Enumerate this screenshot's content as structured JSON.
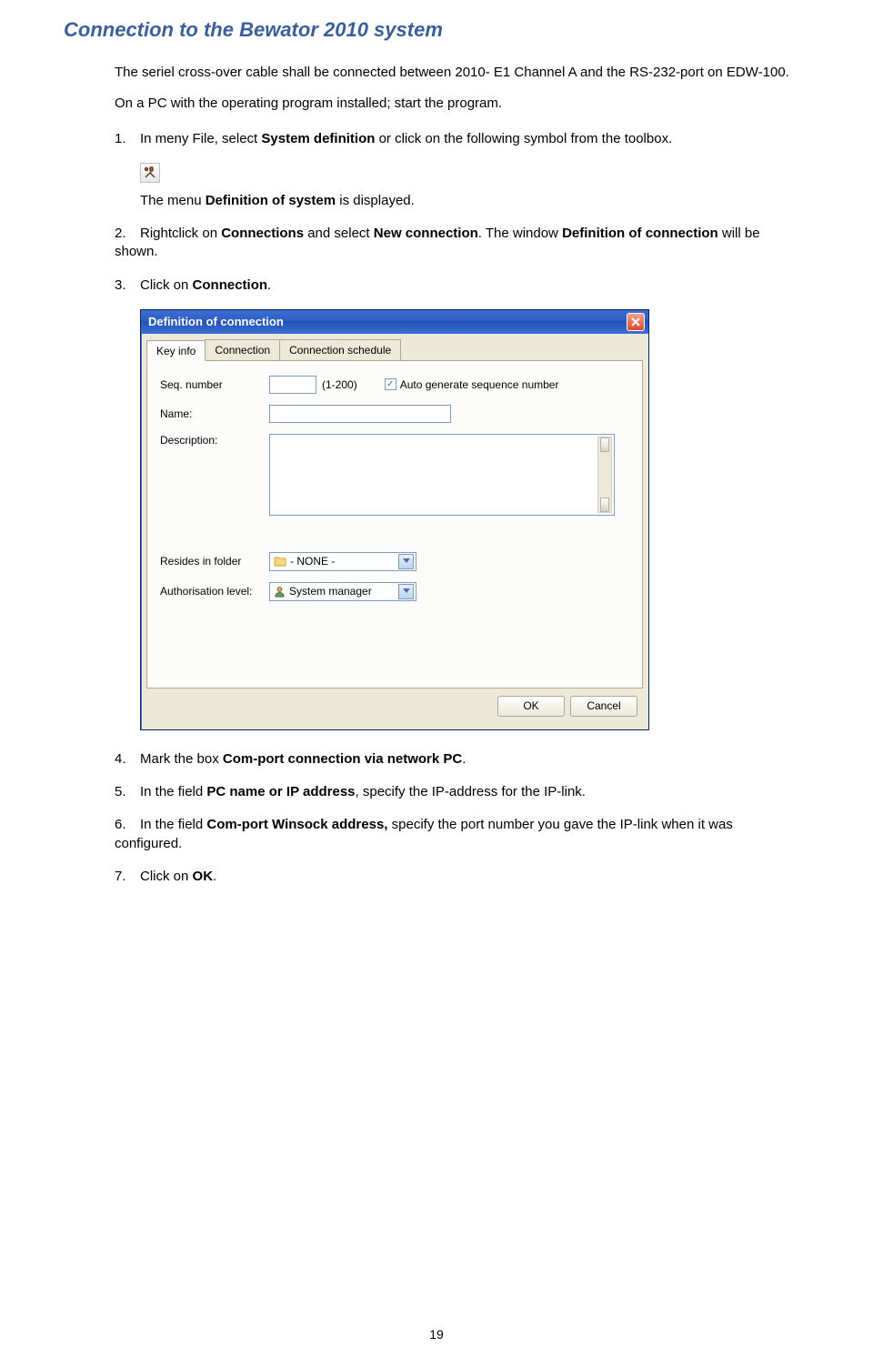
{
  "title": "Connection to the  Bewator 2010 system",
  "intro1": "The seriel cross-over cable shall be connected between 2010- E1 Channel A and the RS-232-port on EDW-100.",
  "intro2": "On a PC with the operating program installed; start the program.",
  "step1_a": "In meny File, select ",
  "step1_b": "System definition",
  "step1_c": " or click on the following symbol from the toolbox.",
  "after_icon_a": "The menu ",
  "after_icon_b": "Definition of system",
  "after_icon_c": " is displayed.",
  "step2_a": "Rightclick on ",
  "step2_b": "Connections",
  "step2_c": " and select ",
  "step2_d": "New connection",
  "step2_e": ". The window ",
  "step2_f": "Definition of connection",
  "step2_g": " will be shown.",
  "step3_a": "Click on ",
  "step3_b": "Connection",
  "step3_c": ".",
  "step4_a": "Mark the box ",
  "step4_b": "Com-port connection via network PC",
  "step4_c": ".",
  "step5_a": "In the field ",
  "step5_b": "PC name or IP address",
  "step5_c": ", specify the IP-address for the IP-link.",
  "step6_a": "In the field ",
  "step6_b": "Com-port Winsock address,",
  "step6_c": " specify the port number you gave the IP-link when it was configured.",
  "step7_a": "Click on ",
  "step7_b": "OK",
  "step7_c": ".",
  "dialog": {
    "title": "Definition of connection",
    "tabs": [
      "Key info",
      "Connection",
      "Connection schedule"
    ],
    "labels": {
      "seq": "Seq. number",
      "range": "(1-200)",
      "autogen": "Auto generate sequence number",
      "name": "Name:",
      "desc": "Description:",
      "resides": "Resides in folder",
      "auth": "Authorisation level:"
    },
    "values": {
      "seq": "",
      "name": "",
      "folder": "- NONE -",
      "auth": "System manager"
    },
    "buttons": {
      "ok": "OK",
      "cancel": "Cancel"
    }
  },
  "pagenum": "19"
}
